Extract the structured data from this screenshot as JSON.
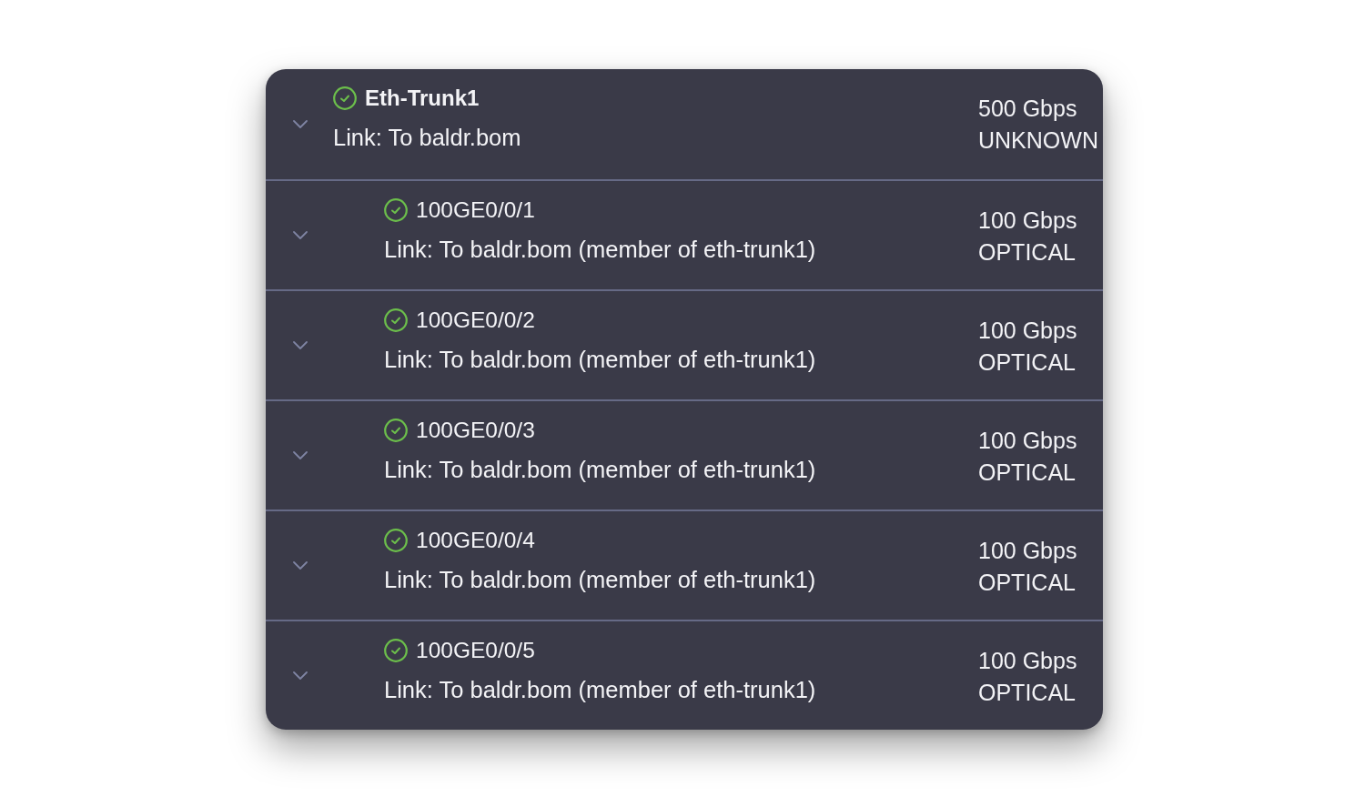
{
  "interfaces": [
    {
      "name": "Eth-Trunk1",
      "connected": true,
      "link": "Link: To baldr.bom",
      "speed": "500 Gbps",
      "media": "UNKNOWN",
      "children": [
        {
          "name": "100GE0/0/1",
          "connected": true,
          "link": "Link: To baldr.bom (member of eth-trunk1)",
          "speed": "100 Gbps",
          "media": "OPTICAL"
        },
        {
          "name": "100GE0/0/2",
          "connected": true,
          "link": "Link: To baldr.bom (member of eth-trunk1)",
          "speed": "100 Gbps",
          "media": "OPTICAL"
        },
        {
          "name": "100GE0/0/3",
          "connected": true,
          "link": "Link: To baldr.bom (member of eth-trunk1)",
          "speed": "100 Gbps",
          "media": "OPTICAL"
        },
        {
          "name": "100GE0/0/4",
          "connected": true,
          "link": "Link: To baldr.bom (member of eth-trunk1)",
          "speed": "100 Gbps",
          "media": "OPTICAL"
        },
        {
          "name": "100GE0/0/5",
          "connected": true,
          "link": "Link: To baldr.bom (member of eth-trunk1)",
          "speed": "100 Gbps",
          "media": "OPTICAL"
        }
      ]
    }
  ]
}
